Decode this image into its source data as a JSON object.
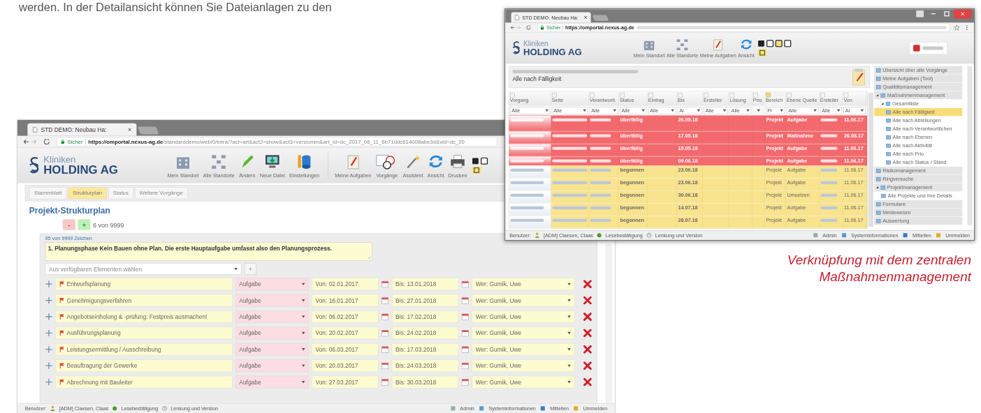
{
  "intro_text": "werden. In der Detailansicht können Sie Dateianlagen zu den",
  "caption_lines": [
    "Verknüpfung mit dem zentralen",
    "Maßnahmenmanagement"
  ],
  "detail_window": {
    "tab": {
      "title": "STD DEMO: Neubau Ha:",
      "close": "×"
    },
    "address": {
      "secure": "Sicher",
      "url_host": "https://omportal.nexus-ag.de",
      "url_path": "/standarddemo/web/0/intra/?act=art&act2=show&act3=versionen&art_id=dc_2017_06_11_6b71ddc614008abe3d&vid=dc_20"
    },
    "logo": {
      "line_1": "Kliniken",
      "line_2": "HOLDING AG"
    },
    "toolbar": [
      {
        "label": "Mein Standort"
      },
      {
        "label": "Alle Standorte"
      },
      {
        "label": "Ändern"
      },
      {
        "label": "Neue Datei"
      },
      {
        "label": "Einstellungen"
      },
      {
        "label": "Meine Aufgaben"
      },
      {
        "label": "Vorgänge"
      },
      {
        "label": "Assistent"
      },
      {
        "label": "Ansicht"
      },
      {
        "label": "Drucken"
      }
    ],
    "tabs": [
      {
        "label": "Stammblatt",
        "selected": false
      },
      {
        "label": "Strukturplan",
        "selected": true
      },
      {
        "label": "Status",
        "selected": false
      },
      {
        "label": "Weitere Vorgänge",
        "selected": false
      }
    ],
    "heading": "Projekt-Strukturplan",
    "minus": "-",
    "plus": "+",
    "count": "6 von 9999",
    "text_counter": "95 von 9999 Zeichen",
    "text_value": "1. Planungsphase Kein Bauen ohne Plan. Die erste Hauptaufgabe umfasst also den Planungsprozess.",
    "element_select": {
      "placeholder": "Aus verfügbaren Elementen wählen",
      "add": "+"
    },
    "tasks": [
      {
        "name": "Entwurfsplanung",
        "type": "Aufgabe",
        "from": "Von: 02.01.2017",
        "to": "Bis: 13.01.2018",
        "who": "Wer: Gumik, Uwe"
      },
      {
        "name": "Genehmigungsverfahren",
        "type": "Aufgabe",
        "from": "Von: 16.01.2017",
        "to": "Bis: 27.01.2018",
        "who": "Wer: Gumik, Uwe"
      },
      {
        "name": "Angebotseinholung & -prüfung: Festpreis ausmachen!",
        "type": "Aufgabe",
        "from": "Von: 06.02.2017",
        "to": "Bis: 17.02.2018",
        "who": "Wer: Gumik, Uwe"
      },
      {
        "name": "Ausführungsplanung",
        "type": "Aufgabe",
        "from": "Von: 20.02.2017",
        "to": "Bis: 24.02.2018",
        "who": "Wer: Gumik, Uwe"
      },
      {
        "name": "Leistungsermittlung / Ausschreibung",
        "type": "Aufgabe",
        "from": "Von: 06.03.2017",
        "to": "Bis: 17.03.2018",
        "who": "Wer: Gumik, Uwe"
      },
      {
        "name": "Beauftragung der Gewerke",
        "type": "Aufgabe",
        "from": "Von: 20.03.2017",
        "to": "Bis: 24.03.2018",
        "who": "Wer: Gumik, Uwe"
      },
      {
        "name": "Abrechnung mit Bauleiter",
        "type": "Aufgabe",
        "from": "Von: 27.03.2017",
        "to": "Bis: 30.03.2018",
        "who": "Wer: Gumik, Uwe"
      }
    ],
    "status_bar": {
      "left": [
        "Benutzer:",
        "[ADM] Claesen, Claas",
        "Lesebestätigung",
        "Lenkung und Version"
      ],
      "right": [
        "Admin",
        "Systeminformationen",
        "Mitteilen",
        "Ummelden"
      ]
    }
  },
  "list_window": {
    "tab": {
      "title": "STD DEMO: Neubau Ha:",
      "close": "×"
    },
    "address": {
      "secure": "Sicher",
      "url_host": "https://omportal.nexus-ag.de"
    },
    "logo": {
      "line_1": "Kliniken",
      "line_2": "HOLDING AG"
    },
    "toolbar": [
      {
        "label": "Mein Standort"
      },
      {
        "label": "Alle Standorte"
      },
      {
        "label": "Meine Aufgaben"
      },
      {
        "label": "Ansicht"
      }
    ],
    "heading": "Alle nach Fälligkeit",
    "columns": [
      "Vorgang",
      "Seite",
      "Verantwortl.",
      "Status",
      "Eintrag",
      "Bis",
      "Ersteller",
      "Lösung",
      "Prio",
      "Bereich",
      "Ebene Quelle",
      "Ersteller",
      "Von"
    ],
    "filters": [
      "Alle",
      "Alle",
      "Alle",
      "Alle",
      "Alle",
      "Al",
      "Alle",
      "Alle",
      "Pr",
      "Alle",
      "Alle",
      "Al"
    ],
    "rows": [
      {
        "kind": "overdue",
        "status": "überfällig",
        "due": "26.05.18",
        "area": "Projekt",
        "type": "Aufgabe",
        "start": "11.06.17"
      },
      {
        "kind": "overdue",
        "status": "überfällig",
        "due": "17.05.18",
        "area": "Projekt",
        "type": "Maßnahme",
        "start": "26.08.17"
      },
      {
        "kind": "overdue",
        "status": "überfällig",
        "due": "15.05.18",
        "area": "Projekt",
        "type": "Aufgabe",
        "start": "11.06.17"
      },
      {
        "kind": "overdue",
        "status": "überfällig",
        "due": "09.06.18",
        "area": "Projekt",
        "type": "Aufgabe",
        "start": "11.06.17"
      },
      {
        "kind": "open",
        "status": "begonnen",
        "due": "23.06.18",
        "area": "Projekt",
        "type": "Aufgabe",
        "start": "11.06.17"
      },
      {
        "kind": "open",
        "status": "begonnen",
        "due": "23.06.18",
        "area": "Projekt",
        "type": "Aufgabe",
        "start": "11.06.17"
      },
      {
        "kind": "open",
        "status": "begonnen",
        "due": "30.06.18",
        "area": "Projekt",
        "type": "Umsetzen",
        "start": "11.06.17"
      },
      {
        "kind": "open",
        "status": "begonnen",
        "due": "14.07.18",
        "area": "Projekt",
        "type": "Aufgabe",
        "start": "11.06.17"
      },
      {
        "kind": "open",
        "status": "begonnen",
        "due": "28.07.18",
        "area": "Projekt",
        "type": "Aufgabe",
        "start": "11.06.17"
      }
    ],
    "tree": [
      {
        "label": "Übersicht über alle Vorgänge",
        "selected": false
      },
      {
        "label": "Meine Aufgaben (Tool)",
        "selected": false
      },
      {
        "label": "Qualitätsmanagement",
        "selected": false
      },
      {
        "label": "Maßnahmenmanagement",
        "selected": false,
        "children": [
          {
            "label": "Gesamtliste",
            "selected": false,
            "children": [
              {
                "label": "Alle nach Fälligkeit",
                "selected": true
              },
              {
                "label": "Alle nach Abteilungen",
                "selected": false
              },
              {
                "label": "Alle nach Verantwortlichen",
                "selected": false
              },
              {
                "label": "Alle nach Ebenen",
                "selected": false
              },
              {
                "label": "Alle nach Aktivität",
                "selected": false
              },
              {
                "label": "Alle nach Prio",
                "selected": false
              },
              {
                "label": "Alle nach Status / Stand",
                "selected": false
              }
            ]
          }
        ]
      },
      {
        "label": "Risikomanagement",
        "selected": false
      },
      {
        "label": "Ringversuche",
        "selected": false
      },
      {
        "label": "Projektmanagement",
        "selected": false,
        "children": [
          {
            "label": "Alle Projekte und ihre Details",
            "selected": false
          }
        ]
      },
      {
        "label": "Formulare",
        "selected": false
      },
      {
        "label": "Meldewesen",
        "selected": false
      },
      {
        "label": "Auswertung",
        "selected": false
      }
    ],
    "status_bar": {
      "left": [
        "Benutzer:",
        "[ADM] Claesen, Claas",
        "Lesebestätigung",
        "Lenkung und Version"
      ],
      "right": [
        "Admin",
        "Systeminformationen",
        "Mitteilen",
        "Ummelden"
      ]
    }
  }
}
